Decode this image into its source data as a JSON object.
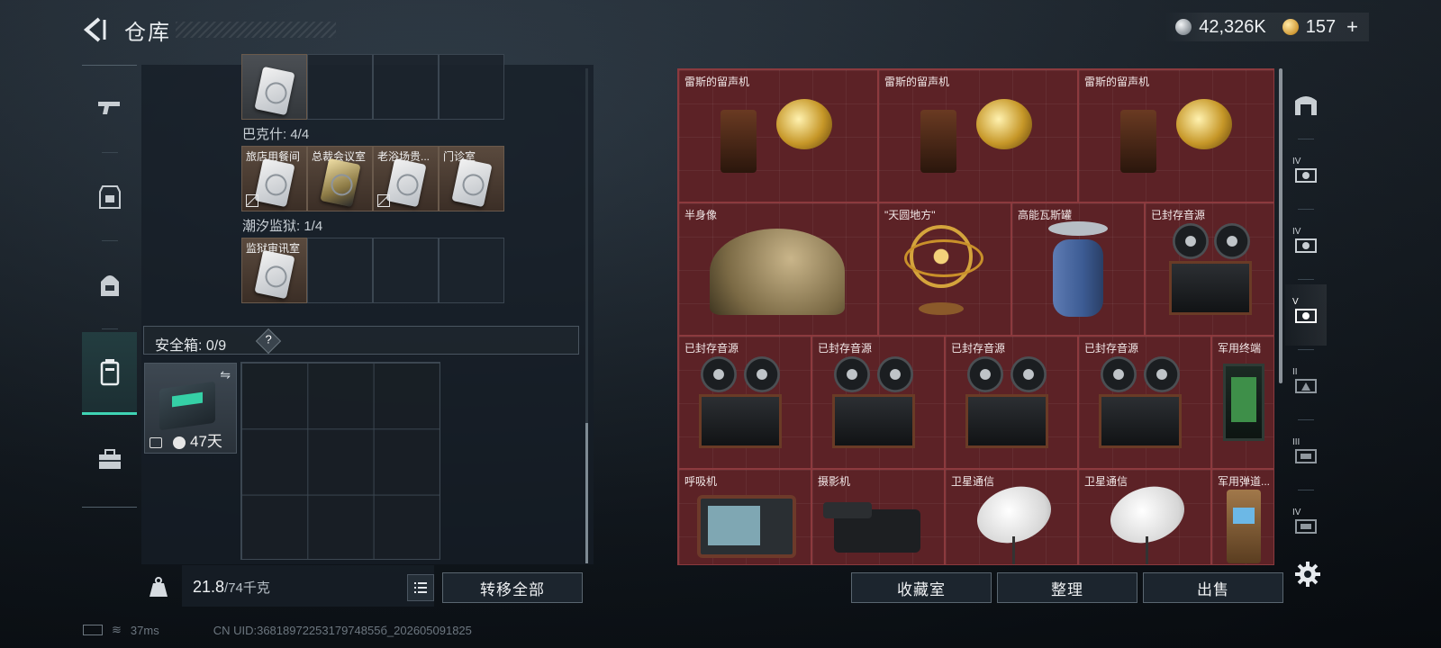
{
  "header": {
    "title": "仓库",
    "currency_silver": "42,326K",
    "currency_gold": "157",
    "plus_label": "+"
  },
  "left_nav": [
    "gun-icon",
    "armor-icon",
    "backpack-icon",
    "container-icon",
    "case-icon"
  ],
  "key_sections": [
    {
      "title": "",
      "items": [
        {
          "label": "",
          "gold": false
        }
      ]
    },
    {
      "title": "巴克什: 4/4",
      "items": [
        {
          "label": "旅店用餐间",
          "gold": false,
          "nobind": true
        },
        {
          "label": "总裁会议室",
          "gold": true,
          "nobind": false
        },
        {
          "label": "老浴场贵...",
          "gold": false,
          "nobind": true
        },
        {
          "label": "门诊室",
          "gold": false,
          "nobind": false
        }
      ]
    },
    {
      "title": "潮汐监狱: 1/4",
      "items": [
        {
          "label": "监狱审讯室",
          "gold": false,
          "nobind": false
        }
      ]
    }
  ],
  "safebox": {
    "label": "安全箱:  0/9",
    "help": "?",
    "days_label": "47天"
  },
  "weight": {
    "current": "21.8",
    "max": "/74千克"
  },
  "buttons": {
    "transfer_all": "转移全部",
    "collection_room": "收藏室",
    "organize": "整理",
    "sell": "出售"
  },
  "status_bar": {
    "ping": "37ms",
    "uid": "CN UID:3681897225317974855б_202605091825"
  },
  "stash_items": [
    {
      "label": "雷斯的留声机",
      "kind": "phonograph"
    },
    {
      "label": "雷斯的留声机",
      "kind": "phonograph"
    },
    {
      "label": "雷斯的留声机",
      "kind": "phonograph"
    },
    {
      "label": "半身像",
      "kind": "bust"
    },
    {
      "label": "\"天圆地方\"",
      "kind": "globe"
    },
    {
      "label": "高能瓦斯罐",
      "kind": "gas"
    },
    {
      "label": "已封存音源",
      "kind": "tape"
    },
    {
      "label": "已封存音源",
      "kind": "tape"
    },
    {
      "label": "已封存音源",
      "kind": "tape"
    },
    {
      "label": "已封存音源",
      "kind": "tape"
    },
    {
      "label": "已封存音源",
      "kind": "tape"
    },
    {
      "label": "军用终端",
      "kind": "terminal"
    },
    {
      "label": "呼吸机",
      "kind": "monitor"
    },
    {
      "label": "摄影机",
      "kind": "camera"
    },
    {
      "label": "卫星通信",
      "kind": "dish"
    },
    {
      "label": "卫星通信",
      "kind": "dish"
    },
    {
      "label": "军用弹道...",
      "kind": "radio"
    }
  ],
  "right_tabs": [
    {
      "name": "stash-tab-main",
      "tier": ""
    },
    {
      "name": "stash-tab-tier4-a",
      "tier": "IV"
    },
    {
      "name": "stash-tab-tier4-b",
      "tier": "IV"
    },
    {
      "name": "stash-tab-tier5",
      "tier": "V"
    },
    {
      "name": "stash-tab-tier2",
      "tier": "II"
    },
    {
      "name": "stash-tab-tier3",
      "tier": "III"
    },
    {
      "name": "stash-tab-tier4-c",
      "tier": "IV"
    }
  ]
}
